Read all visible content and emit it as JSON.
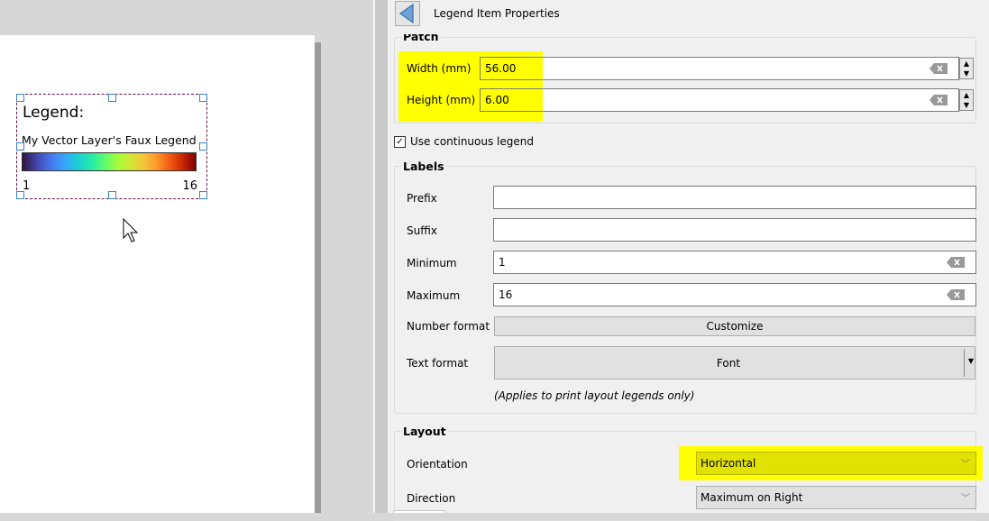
{
  "canvas": {
    "legend_item": {
      "title": "Legend:",
      "layer_name": "My Vector Layer's Faux Legend",
      "min_label": "1",
      "max_label": "16",
      "color_ramp": "turbo"
    }
  },
  "panel": {
    "title": "Legend Item Properties",
    "back_icon": "back-arrow-icon",
    "patch": {
      "group_title": "Patch",
      "width_label": "Width (mm)",
      "width_value": "56.00",
      "height_label": "Height (mm)",
      "height_value": "6.00"
    },
    "use_continuous_legend": {
      "label": "Use continuous legend",
      "checked": true
    },
    "labels": {
      "group_title": "Labels",
      "prefix_label": "Prefix",
      "prefix_value": "",
      "suffix_label": "Suffix",
      "suffix_value": "",
      "minimum_label": "Minimum",
      "minimum_value": "1",
      "maximum_label": "Maximum",
      "maximum_value": "16",
      "number_format_label": "Number format",
      "customize_button": "Customize",
      "text_format_label": "Text format",
      "font_button": "Font",
      "note": "(Applies to print layout legends only)"
    },
    "layout": {
      "group_title": "Layout",
      "orientation_label": "Orientation",
      "orientation_value": "Horizontal",
      "direction_label": "Direction",
      "direction_value": "Maximum on Right"
    }
  },
  "colors": {
    "highlight": "#ffff00",
    "highlight_dim": "#e2e200",
    "selection_handle": "#3b84c4",
    "selection_border": "#6b1040"
  }
}
